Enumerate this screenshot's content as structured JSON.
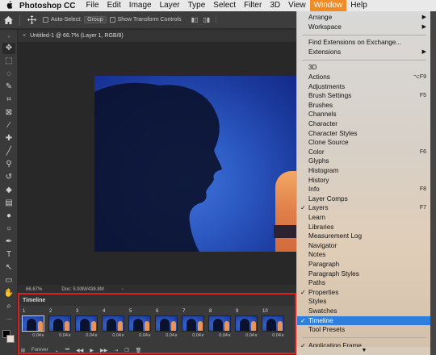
{
  "menubar": {
    "apple": "",
    "app_name": "Photoshop CC",
    "items": [
      "File",
      "Edit",
      "Image",
      "Layer",
      "Type",
      "Select",
      "Filter",
      "3D",
      "View",
      "Window",
      "Help"
    ],
    "active_item": "Window"
  },
  "options_bar": {
    "auto_select_label": "Auto-Select:",
    "auto_select_value": "Group",
    "show_transform_label": "Show Transform Controls"
  },
  "document": {
    "tab_title": "Untitled-1 @ 66.7% (Layer 1, RGB/8)",
    "close_glyph": "×"
  },
  "status": {
    "zoom": "66.67%",
    "doc_info": "Doc: 5.93M/438.8M"
  },
  "timeline": {
    "title": "Timeline",
    "frames": [
      {
        "num": "1",
        "dur": "0.04∨"
      },
      {
        "num": "2",
        "dur": "0.04∨"
      },
      {
        "num": "3",
        "dur": "0.04∨"
      },
      {
        "num": "4",
        "dur": "0.04∨"
      },
      {
        "num": "5",
        "dur": "0.04∨"
      },
      {
        "num": "6",
        "dur": "0.04∨"
      },
      {
        "num": "7",
        "dur": "0.04∨"
      },
      {
        "num": "8",
        "dur": "0.04∨"
      },
      {
        "num": "9",
        "dur": "0.04∨"
      },
      {
        "num": "10",
        "dur": "0.04∨"
      }
    ],
    "loop_value": "Forever"
  },
  "window_menu": {
    "items": [
      {
        "label": "Arrange",
        "submenu": true
      },
      {
        "label": "Workspace",
        "submenu": true
      },
      {
        "divider": true
      },
      {
        "label": "Find Extensions on Exchange..."
      },
      {
        "label": "Extensions",
        "submenu": true
      },
      {
        "divider": true
      },
      {
        "label": "3D"
      },
      {
        "label": "Actions",
        "shortcut": "⌥F9"
      },
      {
        "label": "Adjustments"
      },
      {
        "label": "Brush Settings",
        "shortcut": "F5"
      },
      {
        "label": "Brushes"
      },
      {
        "label": "Channels"
      },
      {
        "label": "Character"
      },
      {
        "label": "Character Styles"
      },
      {
        "label": "Clone Source"
      },
      {
        "label": "Color",
        "shortcut": "F6"
      },
      {
        "label": "Glyphs"
      },
      {
        "label": "Histogram"
      },
      {
        "label": "History"
      },
      {
        "label": "Info",
        "shortcut": "F8"
      },
      {
        "label": "Layer Comps"
      },
      {
        "label": "Layers",
        "shortcut": "F7",
        "checked": true
      },
      {
        "label": "Learn"
      },
      {
        "label": "Libraries"
      },
      {
        "label": "Measurement Log"
      },
      {
        "label": "Navigator"
      },
      {
        "label": "Notes"
      },
      {
        "label": "Paragraph"
      },
      {
        "label": "Paragraph Styles"
      },
      {
        "label": "Paths"
      },
      {
        "label": "Properties",
        "checked": true
      },
      {
        "label": "Styles"
      },
      {
        "label": "Swatches"
      },
      {
        "label": "Timeline",
        "checked": true,
        "highlighted": true
      },
      {
        "label": "Tool Presets"
      },
      {
        "divider": true
      },
      {
        "label": "Application Frame",
        "checked": true
      }
    ],
    "more_glyph": "▼",
    "check_glyph": "✓"
  },
  "colors": {
    "accent_menu": "#f08b25",
    "menu_highlight": "#2e7fdc",
    "timeline_outline": "#d52323"
  }
}
